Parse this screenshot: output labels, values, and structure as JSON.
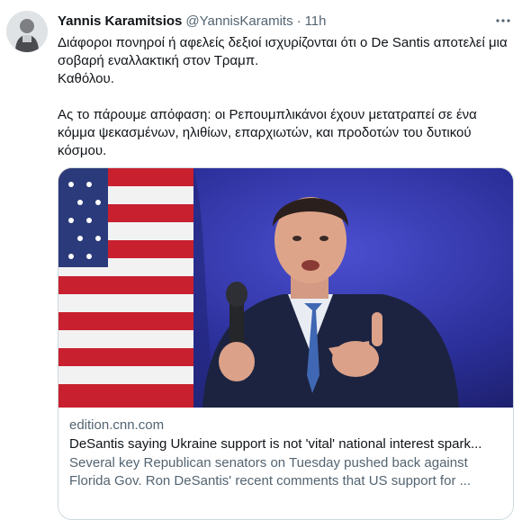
{
  "author": {
    "display_name": "Yannis Karamitsios",
    "handle": "@YannisKaramits",
    "separator": "·",
    "time": "11h"
  },
  "tweet": {
    "line1": "Διάφοροι πονηροί ή αφελείς δεξιοί ισχυρίζονται ότι ο De Santis αποτελεί μια σοβαρή εναλλακτική στον Τραμπ.",
    "line2": "Καθόλου.",
    "line3": "Ας το πάρουμε απόφαση: οι Ρεπουμπλικάνοι έχουν μετατραπεί σε ένα κόμμα ψεκασμένων, ηλιθίων, επαρχιωτών, και προδοτών του δυτικού κόσμου."
  },
  "card": {
    "domain": "edition.cnn.com",
    "title": "DeSantis saying Ukraine support is not 'vital' national interest spark...",
    "description_line1": "Several key Republican senators on Tuesday pushed back against",
    "description_line2": "Florida Gov. Ron DeSantis' recent comments that US support for ..."
  },
  "icons": {
    "more": "more-horizontal-icon"
  },
  "colors": {
    "text_primary": "#0f1419",
    "text_secondary": "#536471",
    "card_border": "#cfd9de",
    "photo_background": "#2a2f8a"
  }
}
